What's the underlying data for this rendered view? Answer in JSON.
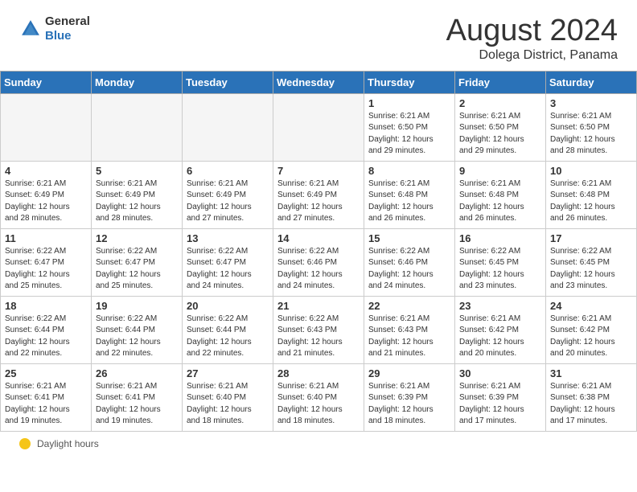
{
  "header": {
    "logo": {
      "line1": "General",
      "line2": "Blue"
    },
    "title": "August 2024",
    "subtitle": "Dolega District, Panama"
  },
  "calendar": {
    "weekdays": [
      "Sunday",
      "Monday",
      "Tuesday",
      "Wednesday",
      "Thursday",
      "Friday",
      "Saturday"
    ],
    "weeks": [
      [
        {
          "day": "",
          "info": ""
        },
        {
          "day": "",
          "info": ""
        },
        {
          "day": "",
          "info": ""
        },
        {
          "day": "",
          "info": ""
        },
        {
          "day": "1",
          "info": "Sunrise: 6:21 AM\nSunset: 6:50 PM\nDaylight: 12 hours\nand 29 minutes."
        },
        {
          "day": "2",
          "info": "Sunrise: 6:21 AM\nSunset: 6:50 PM\nDaylight: 12 hours\nand 29 minutes."
        },
        {
          "day": "3",
          "info": "Sunrise: 6:21 AM\nSunset: 6:50 PM\nDaylight: 12 hours\nand 28 minutes."
        }
      ],
      [
        {
          "day": "4",
          "info": "Sunrise: 6:21 AM\nSunset: 6:49 PM\nDaylight: 12 hours\nand 28 minutes."
        },
        {
          "day": "5",
          "info": "Sunrise: 6:21 AM\nSunset: 6:49 PM\nDaylight: 12 hours\nand 28 minutes."
        },
        {
          "day": "6",
          "info": "Sunrise: 6:21 AM\nSunset: 6:49 PM\nDaylight: 12 hours\nand 27 minutes."
        },
        {
          "day": "7",
          "info": "Sunrise: 6:21 AM\nSunset: 6:49 PM\nDaylight: 12 hours\nand 27 minutes."
        },
        {
          "day": "8",
          "info": "Sunrise: 6:21 AM\nSunset: 6:48 PM\nDaylight: 12 hours\nand 26 minutes."
        },
        {
          "day": "9",
          "info": "Sunrise: 6:21 AM\nSunset: 6:48 PM\nDaylight: 12 hours\nand 26 minutes."
        },
        {
          "day": "10",
          "info": "Sunrise: 6:21 AM\nSunset: 6:48 PM\nDaylight: 12 hours\nand 26 minutes."
        }
      ],
      [
        {
          "day": "11",
          "info": "Sunrise: 6:22 AM\nSunset: 6:47 PM\nDaylight: 12 hours\nand 25 minutes."
        },
        {
          "day": "12",
          "info": "Sunrise: 6:22 AM\nSunset: 6:47 PM\nDaylight: 12 hours\nand 25 minutes."
        },
        {
          "day": "13",
          "info": "Sunrise: 6:22 AM\nSunset: 6:47 PM\nDaylight: 12 hours\nand 24 minutes."
        },
        {
          "day": "14",
          "info": "Sunrise: 6:22 AM\nSunset: 6:46 PM\nDaylight: 12 hours\nand 24 minutes."
        },
        {
          "day": "15",
          "info": "Sunrise: 6:22 AM\nSunset: 6:46 PM\nDaylight: 12 hours\nand 24 minutes."
        },
        {
          "day": "16",
          "info": "Sunrise: 6:22 AM\nSunset: 6:45 PM\nDaylight: 12 hours\nand 23 minutes."
        },
        {
          "day": "17",
          "info": "Sunrise: 6:22 AM\nSunset: 6:45 PM\nDaylight: 12 hours\nand 23 minutes."
        }
      ],
      [
        {
          "day": "18",
          "info": "Sunrise: 6:22 AM\nSunset: 6:44 PM\nDaylight: 12 hours\nand 22 minutes."
        },
        {
          "day": "19",
          "info": "Sunrise: 6:22 AM\nSunset: 6:44 PM\nDaylight: 12 hours\nand 22 minutes."
        },
        {
          "day": "20",
          "info": "Sunrise: 6:22 AM\nSunset: 6:44 PM\nDaylight: 12 hours\nand 22 minutes."
        },
        {
          "day": "21",
          "info": "Sunrise: 6:22 AM\nSunset: 6:43 PM\nDaylight: 12 hours\nand 21 minutes."
        },
        {
          "day": "22",
          "info": "Sunrise: 6:21 AM\nSunset: 6:43 PM\nDaylight: 12 hours\nand 21 minutes."
        },
        {
          "day": "23",
          "info": "Sunrise: 6:21 AM\nSunset: 6:42 PM\nDaylight: 12 hours\nand 20 minutes."
        },
        {
          "day": "24",
          "info": "Sunrise: 6:21 AM\nSunset: 6:42 PM\nDaylight: 12 hours\nand 20 minutes."
        }
      ],
      [
        {
          "day": "25",
          "info": "Sunrise: 6:21 AM\nSunset: 6:41 PM\nDaylight: 12 hours\nand 19 minutes."
        },
        {
          "day": "26",
          "info": "Sunrise: 6:21 AM\nSunset: 6:41 PM\nDaylight: 12 hours\nand 19 minutes."
        },
        {
          "day": "27",
          "info": "Sunrise: 6:21 AM\nSunset: 6:40 PM\nDaylight: 12 hours\nand 18 minutes."
        },
        {
          "day": "28",
          "info": "Sunrise: 6:21 AM\nSunset: 6:40 PM\nDaylight: 12 hours\nand 18 minutes."
        },
        {
          "day": "29",
          "info": "Sunrise: 6:21 AM\nSunset: 6:39 PM\nDaylight: 12 hours\nand 18 minutes."
        },
        {
          "day": "30",
          "info": "Sunrise: 6:21 AM\nSunset: 6:39 PM\nDaylight: 12 hours\nand 17 minutes."
        },
        {
          "day": "31",
          "info": "Sunrise: 6:21 AM\nSunset: 6:38 PM\nDaylight: 12 hours\nand 17 minutes."
        }
      ]
    ]
  },
  "footer": {
    "icon": "sun-icon",
    "label": "Daylight hours"
  }
}
